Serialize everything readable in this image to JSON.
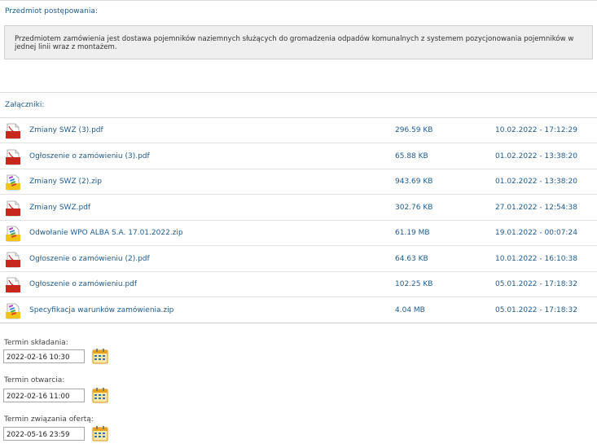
{
  "subject": {
    "label": "Przedmiot postępowania:",
    "text": "Przedmiotem zamówienia jest dostawa pojemników naziemnych służących do gromadzenia odpadów komunalnych z systemem pozycjonowania pojemników w jednej linii wraz z montażem."
  },
  "attachments": {
    "label": "Załączniki:",
    "items": [
      {
        "name": "Zmiany SWZ (3).pdf",
        "size": "296.59 KB",
        "date": "10.02.2022 - 17:12:29",
        "icon": "pdf-file-icon"
      },
      {
        "name": "Ogłoszenie o zamówieniu (3).pdf",
        "size": "65.88 KB",
        "date": "01.02.2022 - 13:38:20",
        "icon": "pdf-file-icon"
      },
      {
        "name": "Zmiany SWZ (2).zip",
        "size": "943.69 KB",
        "date": "01.02.2022 - 13:38:20",
        "icon": "zip-archive-icon"
      },
      {
        "name": "Zmiany SWZ.pdf",
        "size": "302.76 KB",
        "date": "27.01.2022 - 12:54:38",
        "icon": "pdf-file-icon"
      },
      {
        "name": "Odwołanie WPO ALBA S.A. 17.01.2022.zip",
        "size": "61.19 MB",
        "date": "19.01.2022 - 00:07:24",
        "icon": "zip-archive-icon"
      },
      {
        "name": "Ogłoszenie o zamówieniu (2).pdf",
        "size": "64.63 KB",
        "date": "10.01.2022 - 16:10:38",
        "icon": "pdf-file-icon"
      },
      {
        "name": "Ogłoszenie o zamówieniu.pdf",
        "size": "102.25 KB",
        "date": "05.01.2022 - 17:18:32",
        "icon": "pdf-file-icon"
      },
      {
        "name": "Specyfikacja warunków zamówienia.zip",
        "size": "4.04 MB",
        "date": "05.01.2022 - 17:18:32",
        "icon": "zip-archive-icon"
      }
    ]
  },
  "deadlines": {
    "submission": {
      "label": "Termin składania:",
      "value": "2022-02-16 10:30"
    },
    "opening": {
      "label": "Termin otwarcia:",
      "value": "2022-02-16 11:00"
    },
    "binding": {
      "label": "Termin związania ofertą:",
      "value": "2022-05-16 23:59"
    }
  },
  "colors": {
    "link": "#1e5a8f",
    "pdf_red": "#c8281c",
    "zip_yellow": "#f2c417",
    "calendar_orange": "#e8a21c"
  }
}
